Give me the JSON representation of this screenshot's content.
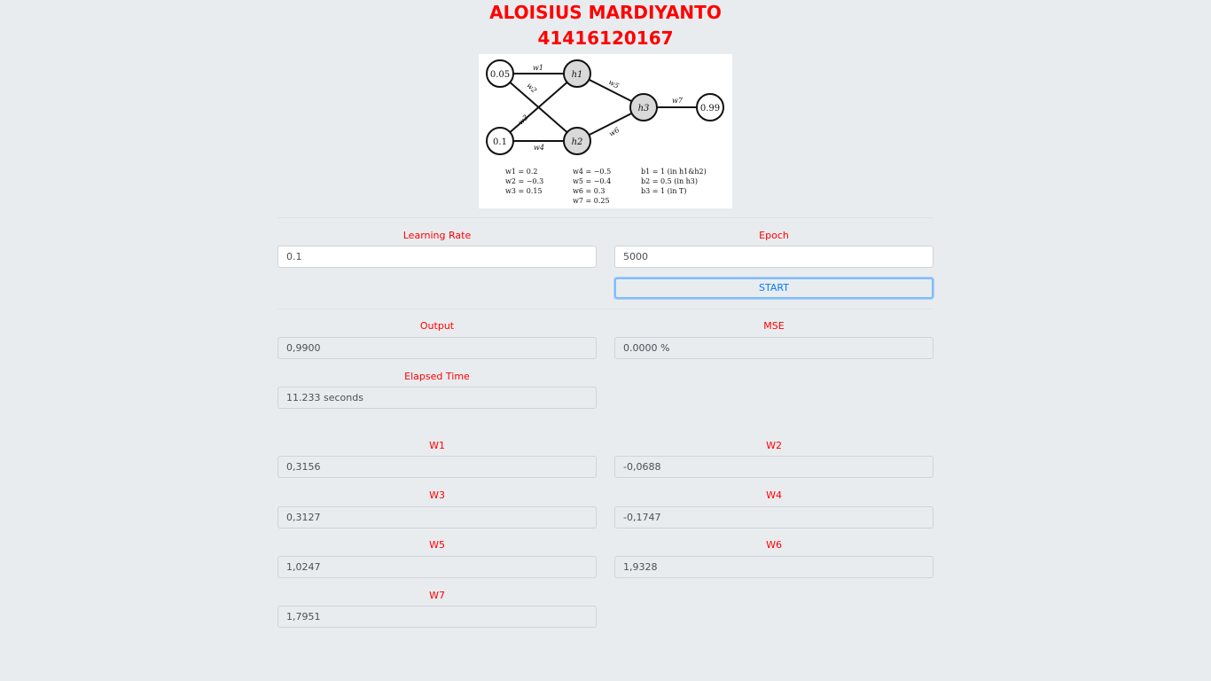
{
  "header": {
    "name": "ALOISIUS MARDIYANTO",
    "id": "41416120167"
  },
  "diagram": {
    "inputs": [
      "0.05",
      "0.1"
    ],
    "target": "0.99",
    "hidden": [
      "h1",
      "h2",
      "h3"
    ],
    "edge_labels": [
      "w1",
      "w2",
      "w3",
      "w4",
      "w5",
      "w6",
      "w7"
    ],
    "legend_col1": [
      "w1 = 0.2",
      "w2 = −0.3",
      "w3 = 0.15"
    ],
    "legend_col2": [
      "w4 = −0.5",
      "w5 = −0.4",
      "w6 = 0.3",
      "w7 = 0.25"
    ],
    "legend_col3": [
      "b1 = 1 (in h1&h2)",
      "b2 = 0.5 (in h3)",
      "b3 = 1 (in T)"
    ]
  },
  "form": {
    "learning_rate_label": "Learning Rate",
    "learning_rate_value": "0.1",
    "epoch_label": "Epoch",
    "epoch_value": "5000",
    "start_label": "START"
  },
  "results": {
    "output_label": "Output",
    "output_value": "0,9900",
    "mse_label": "MSE",
    "mse_value": "0.0000 %",
    "elapsed_label": "Elapsed Time",
    "elapsed_value": "11.233 seconds"
  },
  "weights": {
    "w1_label": "W1",
    "w1_value": "0,3156",
    "w2_label": "W2",
    "w2_value": "-0,0688",
    "w3_label": "W3",
    "w3_value": "0,3127",
    "w4_label": "W4",
    "w4_value": "-0,1747",
    "w5_label": "W5",
    "w5_value": "1,0247",
    "w6_label": "W6",
    "w6_value": "1,9328",
    "w7_label": "W7",
    "w7_value": "1,7951"
  }
}
